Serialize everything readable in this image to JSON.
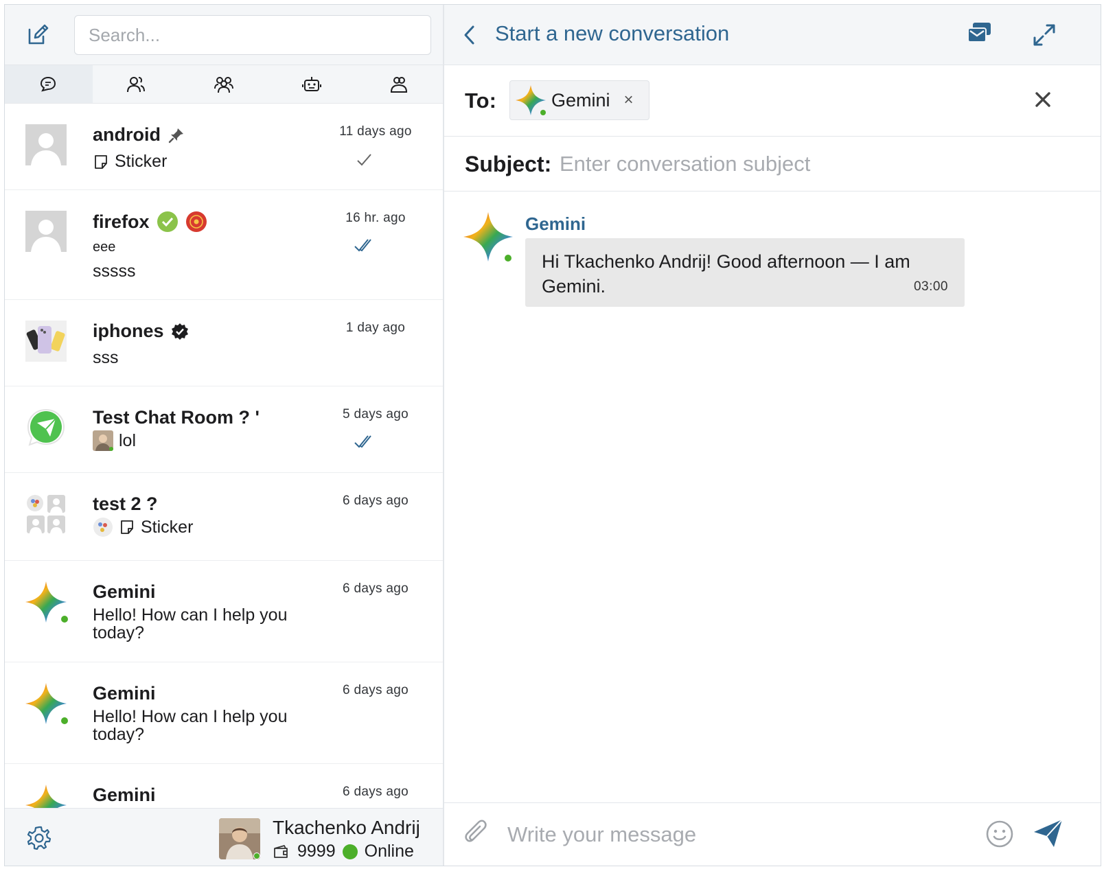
{
  "search": {
    "placeholder": "Search..."
  },
  "tabs": [
    {
      "icon": "chat-bubbles-icon",
      "active": true
    },
    {
      "icon": "users-icon",
      "active": false
    },
    {
      "icon": "group-icon",
      "active": false
    },
    {
      "icon": "bot-icon",
      "active": false
    },
    {
      "icon": "contacts-icon",
      "active": false
    }
  ],
  "conversations": [
    {
      "name": "android",
      "time": "11 days ago",
      "preview": "Sticker",
      "pinned": true,
      "status": "read-single"
    },
    {
      "name": "firefox",
      "time": "16 hr. ago",
      "preview_line1": "eee",
      "preview_line2": "sssss",
      "status": "read-double"
    },
    {
      "name": "iphones",
      "time": "1 day ago",
      "preview": "sss",
      "verified": true
    },
    {
      "name": "Test Chat Room ? '",
      "time": "5 days ago",
      "preview": "lol",
      "status": "read-double"
    },
    {
      "name": "test 2 ?",
      "time": "6 days ago",
      "preview": "Sticker"
    },
    {
      "name": "Gemini",
      "time": "6 days ago",
      "preview": "Hello! How can I help you today?"
    },
    {
      "name": "Gemini",
      "time": "6 days ago",
      "preview": "Hello! How can I help you today?"
    },
    {
      "name": "Gemini",
      "time": "6 days ago"
    }
  ],
  "me": {
    "name": "Tkachenko Andrij",
    "balance": "9999",
    "status": "Online"
  },
  "right": {
    "title": "Start a new conversation",
    "to_label": "To:",
    "recipient": "Gemini",
    "chip_remove": "×",
    "subject_label": "Subject:",
    "subject_placeholder": "Enter conversation subject",
    "message_placeholder": "Write your message"
  },
  "message": {
    "sender": "Gemini",
    "text": "Hi Tkachenko Andrij! Good afternoon — I am Gemini.",
    "time": "03:00"
  },
  "colors": {
    "accent": "#2f6690",
    "online": "#4caf2a",
    "bubble": "#e8e8e8",
    "header_bg": "#f4f6f8"
  }
}
